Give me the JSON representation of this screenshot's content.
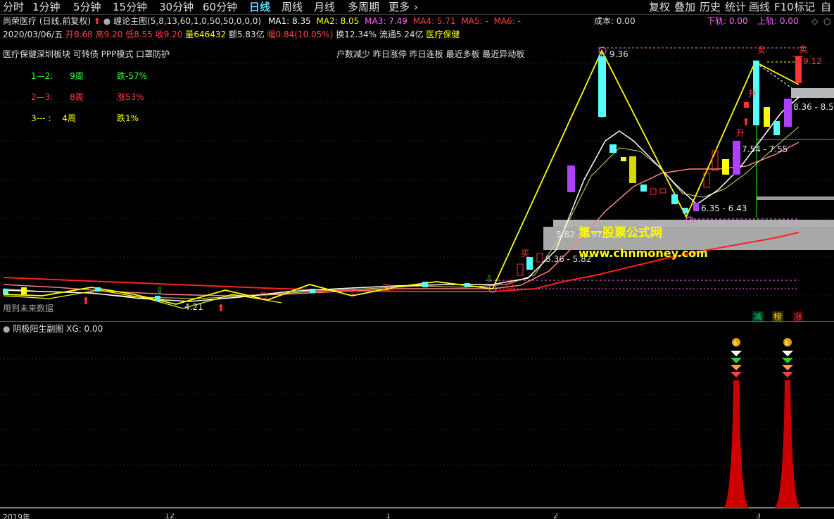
{
  "toolbar": {
    "periods": [
      "分时",
      "1分钟",
      "5分钟",
      "15分钟",
      "30分钟",
      "60分钟",
      "日线",
      "周线",
      "月线",
      "多周期",
      "更多"
    ],
    "active_period": "日线",
    "more_arrow": "›",
    "right_items": [
      "复权",
      "叠加",
      "历史",
      "统计",
      "画线",
      "F10",
      "标记",
      "自"
    ]
  },
  "header": {
    "stock_name": "尚荣医疗",
    "mode": "(日线,前复权)",
    "up_arrow_icon": "up-arrow-icon",
    "indicator_name": "缠论主图",
    "indicator_params": "(5,8,13,60,1,0,50,50,0,0,0)",
    "ma": [
      {
        "label": "MA1: 8.35",
        "color": "#ffffff"
      },
      {
        "label": "MA2: 8.05",
        "color": "#ffff00"
      },
      {
        "label": "MA3: 7.49",
        "color": "#ff66ff"
      },
      {
        "label": "MA4: 5.71",
        "color": "#ff4040"
      },
      {
        "label": "MA5: -",
        "color": "#ff4040"
      },
      {
        "label": "MA6: -",
        "color": "#ff4040"
      }
    ],
    "cost": "成本: 0.00",
    "lower_rail": "下轨: 0.00",
    "upper_rail": "上轨: 0.00"
  },
  "quote": {
    "date": "2020/03/06/五",
    "open_label": "开",
    "open": "8.68",
    "high_label": "高",
    "high": "9.20",
    "low_label": "低",
    "low": "8.55",
    "close_label": "收",
    "close": "9.20",
    "volume_label": "量",
    "volume": "646432",
    "amount_label": "额",
    "amount": "5.83亿",
    "change_label": "幅",
    "change": "0.84(10.05%)",
    "turnover_label": "换",
    "turnover": "12.34%",
    "float_label": "流通",
    "float": "5.24亿",
    "sector": "医疗保健"
  },
  "concepts": {
    "left": "医疗保健深圳板块 可转债 PPP模式 口罩防护",
    "right": "户数减少 昨日涨停 昨日连板 最近多板 最近异动板",
    "overlap_fragments": [
      "医疗保健",
      "异动"
    ]
  },
  "stats": [
    {
      "label": "1—2:",
      "weeks": "9周",
      "result": "跌-57%",
      "color": "#33ff33"
    },
    {
      "label": "2—3:",
      "weeks": "8周",
      "result": "涨53%",
      "color": "#ff4040"
    },
    {
      "label": "3--- :",
      "weeks": "4周",
      "result": "跌1%",
      "color": "#ffff00"
    }
  ],
  "price_labels": {
    "peak": "9.36",
    "last_high": "9.12",
    "zone_a": "8.36 - 8.5",
    "zone_b": "7.54 - 7.55",
    "zone_c": "6.35 - 6.43",
    "zone_d": "5.82 - 5.97",
    "zone_e": "5.36 - 5.82",
    "low": "4.21"
  },
  "markers": {
    "sell": "卖",
    "buy": "买",
    "rise": "升",
    "bottom_left": "用到未来数据"
  },
  "watermark": {
    "line1": "第一股票公式网",
    "line2": "www.chnmoney.com"
  },
  "legend_tags": [
    {
      "label": "减",
      "color": "#00cc66"
    },
    {
      "label": "榜",
      "color": "#ffd700"
    },
    {
      "label": "涨",
      "color": "#ff4040"
    }
  ],
  "sub_chart": {
    "title": "阴极阳生副图",
    "value": "XG: 0.00"
  },
  "x_axis": {
    "labels": [
      "2019年",
      "12",
      "1",
      "2",
      "3"
    ]
  },
  "colors": {
    "up": "#ff3333",
    "down": "#55ffff",
    "yellow_line": "#ffff00",
    "ma_white": "#ffffff",
    "ma_pink": "#ff8080",
    "ma_red": "#ff2020",
    "purple_candle": "#b040ff",
    "yellow_candle": "#ffff00"
  }
}
